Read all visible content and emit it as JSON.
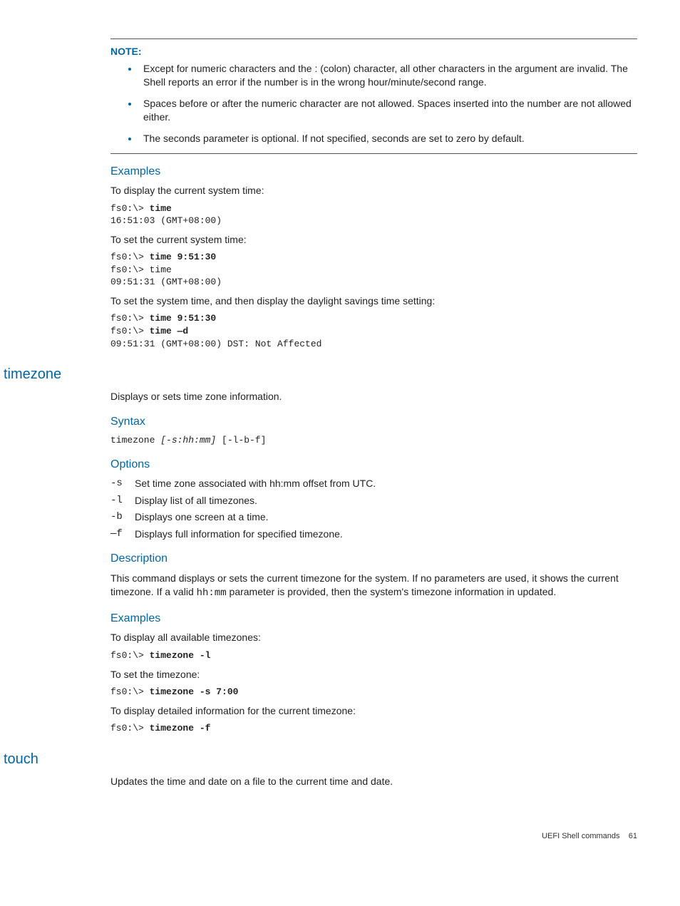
{
  "note": {
    "title": "NOTE:",
    "items": [
      "Except for numeric characters and the : (colon) character, all other characters in the argument are invalid. The Shell reports an error if the number is in the wrong hour/minute/second range.",
      "Spaces before or after the numeric character are not allowed. Spaces inserted into the number are not allowed either.",
      "The seconds parameter is optional. If not specified, seconds are set to zero by default."
    ]
  },
  "examples1": {
    "heading": "Examples",
    "p1": "To display the current system time:",
    "code1_prompt": "fs0:\\> ",
    "code1_cmd": "time",
    "code1_out": "16:51:03 (GMT+08:00)",
    "p2": "To set the current system time:",
    "code2_prompt1": "fs0:\\> ",
    "code2_cmd1": "time 9:51:30",
    "code2_line2": "fs0:\\> time",
    "code2_out": "09:51:31 (GMT+08:00)",
    "p3": "To set the system time, and then display the daylight savings time setting:",
    "code3_prompt1": "fs0:\\> ",
    "code3_cmd1": "time 9:51:30",
    "code3_prompt2": "fs0:\\> ",
    "code3_cmd2": "time —d",
    "code3_out": "09:51:31 (GMT+08:00) DST: Not Affected"
  },
  "timezone": {
    "heading": "timezone",
    "intro": "Displays or sets time zone information.",
    "syntax_h": "Syntax",
    "syntax_pre": "timezone ",
    "syntax_ital": "[-s:hh:mm]",
    "syntax_post": " [-l-b-f]",
    "options_h": "Options",
    "opts": [
      {
        "k": "-s",
        "v": "Set time zone associated with hh:mm offset from UTC."
      },
      {
        "k": "-l",
        "v": "Display list of all timezones."
      },
      {
        "k": "-b",
        "v": "Displays one screen at a time."
      },
      {
        "k": "—f",
        "v": "Displays full information for specified timezone."
      }
    ],
    "desc_h": "Description",
    "desc_p1": "This command displays or sets the current timezone for the system. If no parameters are used, it shows the current timezone. If a valid ",
    "desc_mono": "hh:mm",
    "desc_p2": " parameter is provided, then the system's timezone information in updated.",
    "ex_h": "Examples",
    "ex_p1": "To display all available timezones:",
    "ex_c1_prompt": "fs0:\\> ",
    "ex_c1_cmd": "timezone -l",
    "ex_p2": "To set the timezone:",
    "ex_c2_prompt": "fs0:\\> ",
    "ex_c2_cmd": "timezone -s 7:00",
    "ex_p3": "To display detailed information for the current timezone:",
    "ex_c3_prompt": "fs0:\\> ",
    "ex_c3_cmd": "timezone -f"
  },
  "touch": {
    "heading": "touch",
    "intro": "Updates the time and date on a file to the current time and date."
  },
  "footer": {
    "text": "UEFI Shell commands",
    "page": "61"
  }
}
